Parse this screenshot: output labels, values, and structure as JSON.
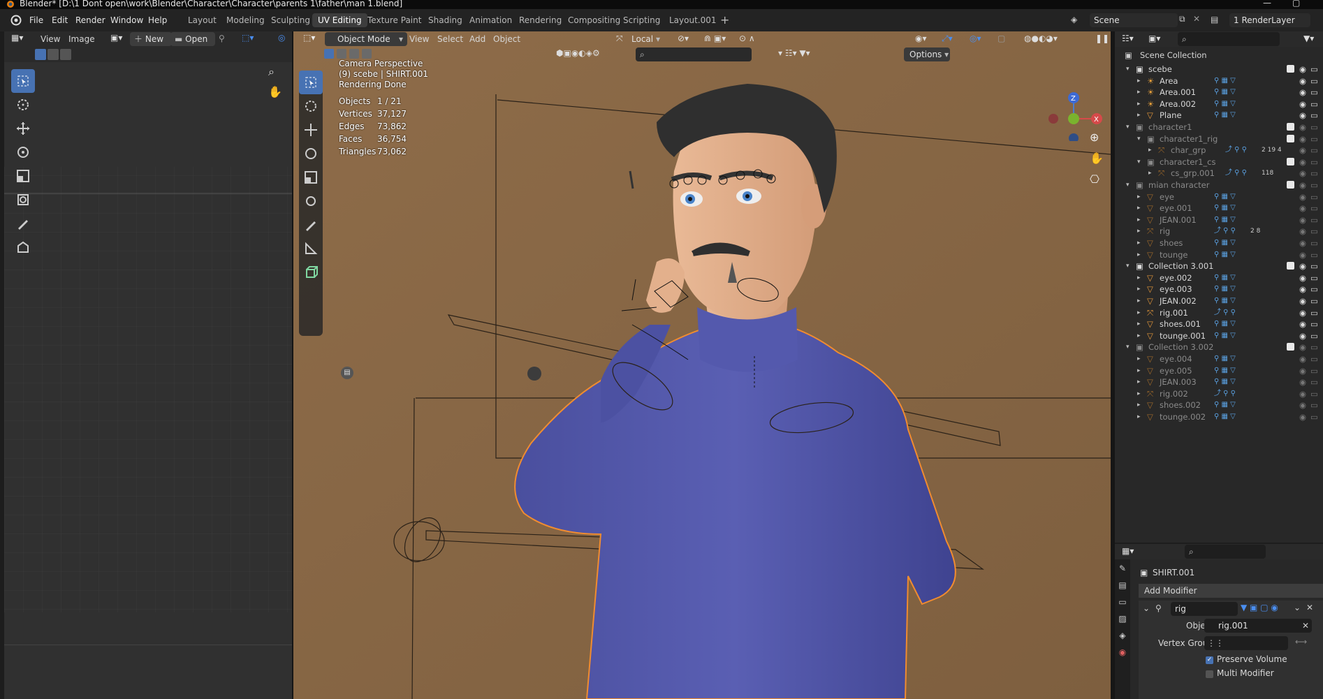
{
  "title_bar": {
    "text": "Blender* [D:\\1 Dont open\\work\\Blender\\Character\\Character\\parents 1\\father\\man 1.blend]"
  },
  "menu": {
    "file": "File",
    "edit": "Edit",
    "render": "Render",
    "window": "Window",
    "help": "Help"
  },
  "workspaces": [
    "Layout",
    "Modeling",
    "Sculpting",
    "UV Editing",
    "Texture Paint",
    "Shading",
    "Animation",
    "Rendering",
    "Compositing",
    "Scripting",
    "Layout.001"
  ],
  "active_workspace": "UV Editing",
  "scene": {
    "name": "Scene",
    "view_layer": "1 RenderLayer"
  },
  "uv_editor": {
    "view": "View",
    "image": "Image",
    "new": "New",
    "open": "Open"
  },
  "viewport": {
    "mode": "Object Mode",
    "menus": [
      "View",
      "Select",
      "Add",
      "Object"
    ],
    "orientation": "Local",
    "options": "Options",
    "overlay": {
      "line1": "Camera Perspective",
      "line2": "(9) scebe | SHIRT.001",
      "line3": "Rendering Done",
      "stats": [
        {
          "label": "Objects",
          "value": "1 / 21"
        },
        {
          "label": "Vertices",
          "value": "37,127"
        },
        {
          "label": "Edges",
          "value": "73,862"
        },
        {
          "label": "Faces",
          "value": "36,754"
        },
        {
          "label": "Triangles",
          "value": "73,062"
        }
      ]
    },
    "axis": {
      "z": "Z",
      "x": "X"
    }
  },
  "outliner": {
    "root": "Scene Collection",
    "rows": [
      {
        "name": "scebe",
        "type": "collection",
        "indent": 0,
        "dim": false,
        "check": true
      },
      {
        "name": "Area",
        "type": "light",
        "indent": 1,
        "dim": false
      },
      {
        "name": "Area.001",
        "type": "light",
        "indent": 1,
        "dim": false
      },
      {
        "name": "Area.002",
        "type": "light",
        "indent": 1,
        "dim": false
      },
      {
        "name": "Plane",
        "type": "mesh",
        "indent": 1,
        "dim": false
      },
      {
        "name": "character1",
        "type": "collection",
        "indent": 0,
        "dim": true,
        "check": true
      },
      {
        "name": "character1_rig",
        "type": "collection",
        "indent": 1,
        "dim": true,
        "check": true
      },
      {
        "name": "char_grp",
        "type": "armature",
        "indent": 2,
        "dim": true,
        "badge": "2 19 4"
      },
      {
        "name": "character1_cs",
        "type": "collection",
        "indent": 1,
        "dim": true,
        "check": true
      },
      {
        "name": "cs_grp.001",
        "type": "armature",
        "indent": 2,
        "dim": true,
        "badge": "118"
      },
      {
        "name": "mian character",
        "type": "collection",
        "indent": 0,
        "dim": true,
        "check": true
      },
      {
        "name": "eye",
        "type": "mesh",
        "indent": 1,
        "dim": true
      },
      {
        "name": "eye.001",
        "type": "mesh",
        "indent": 1,
        "dim": true
      },
      {
        "name": "JEAN.001",
        "type": "mesh",
        "indent": 1,
        "dim": true
      },
      {
        "name": "rig",
        "type": "armature",
        "indent": 1,
        "dim": true,
        "badge": "2 8"
      },
      {
        "name": "shoes",
        "type": "mesh",
        "indent": 1,
        "dim": true
      },
      {
        "name": "tounge",
        "type": "mesh",
        "indent": 1,
        "dim": true
      },
      {
        "name": "Collection 3.001",
        "type": "collection",
        "indent": 0,
        "dim": false,
        "check": true
      },
      {
        "name": "eye.002",
        "type": "mesh",
        "indent": 1,
        "dim": false
      },
      {
        "name": "eye.003",
        "type": "mesh",
        "indent": 1,
        "dim": false
      },
      {
        "name": "JEAN.002",
        "type": "mesh",
        "indent": 1,
        "dim": false
      },
      {
        "name": "rig.001",
        "type": "armature",
        "indent": 1,
        "dim": false
      },
      {
        "name": "shoes.001",
        "type": "mesh",
        "indent": 1,
        "dim": false
      },
      {
        "name": "tounge.001",
        "type": "mesh",
        "indent": 1,
        "dim": false
      },
      {
        "name": "Collection 3.002",
        "type": "collection",
        "indent": 0,
        "dim": true,
        "check": true
      },
      {
        "name": "eye.004",
        "type": "mesh",
        "indent": 1,
        "dim": true
      },
      {
        "name": "eye.005",
        "type": "mesh",
        "indent": 1,
        "dim": true
      },
      {
        "name": "JEAN.003",
        "type": "mesh",
        "indent": 1,
        "dim": true
      },
      {
        "name": "rig.002",
        "type": "armature",
        "indent": 1,
        "dim": true
      },
      {
        "name": "shoes.002",
        "type": "mesh",
        "indent": 1,
        "dim": true
      },
      {
        "name": "tounge.002",
        "type": "mesh",
        "indent": 1,
        "dim": true
      }
    ]
  },
  "properties": {
    "object": "SHIRT.001",
    "add_modifier": "Add Modifier",
    "modifier_name": "rig",
    "object_label": "Object",
    "object_value": "rig.001",
    "vertex_group_label": "Vertex Group",
    "preserve_volume": "Preserve Volume",
    "preserve_volume_checked": true,
    "multi_modifier": "Multi Modifier",
    "multi_modifier_checked": false
  },
  "colors": {
    "accent": "#4772b3",
    "viewport_bg": "#8a6a48",
    "shirt": "#5257a8",
    "orange": "#e8953a"
  }
}
